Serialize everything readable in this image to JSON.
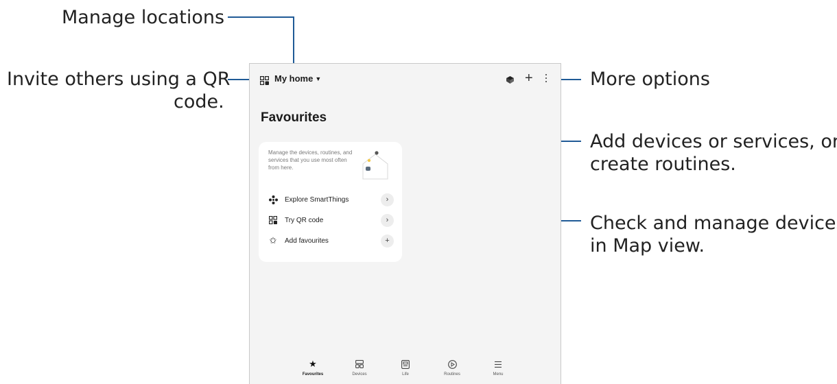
{
  "callouts": {
    "manage_locations": "Manage locations",
    "invite_line1": "Invite others using a QR",
    "invite_line2": "code.",
    "more_options": "More options",
    "add_line1": "Add devices or services, or",
    "add_line2": "create routines.",
    "check_line1": "Check and manage devices",
    "check_line2": "in Map view."
  },
  "colors": {
    "callout_line": "#1f5a96",
    "screen_bg": "#f4f4f4",
    "card_bg": "#ffffff"
  },
  "header": {
    "location": "My home",
    "icons": [
      "qr-code-icon",
      "map-view-icon",
      "plus-icon",
      "more-options-icon"
    ]
  },
  "main": {
    "title": "Favourites",
    "card": {
      "description": "Manage the devices, routines, and services that you use most often from here.",
      "items": [
        {
          "label": "Explore SmartThings",
          "icon": "smartthings-icon",
          "action": "chevron-right-icon"
        },
        {
          "label": "Try QR code",
          "icon": "qr-code-icon",
          "action": "chevron-right-icon"
        },
        {
          "label": "Add favourites",
          "icon": "star-outline-icon",
          "action": "plus-icon"
        }
      ]
    }
  },
  "bottom_nav": [
    {
      "label": "Favourites",
      "icon": "star-icon",
      "active": true
    },
    {
      "label": "Devices",
      "icon": "devices-icon",
      "active": false
    },
    {
      "label": "Life",
      "icon": "life-icon",
      "active": false
    },
    {
      "label": "Routines",
      "icon": "routines-icon",
      "active": false
    },
    {
      "label": "Menu",
      "icon": "menu-icon",
      "active": false
    }
  ]
}
